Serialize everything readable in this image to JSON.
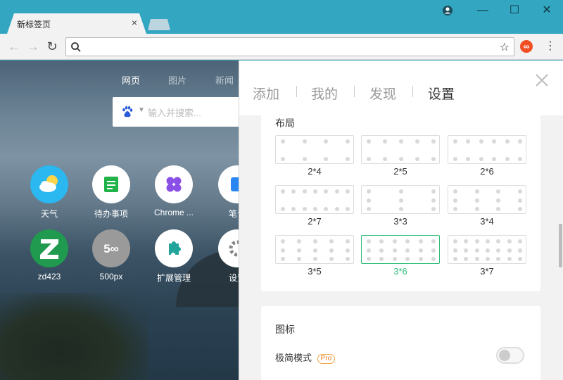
{
  "browser": {
    "tab_title": "新标签页",
    "tab_close": "×",
    "window_controls": {
      "minimize": "—",
      "maximize": "☐",
      "close": "✕"
    },
    "address_value": "",
    "ext_label": "∞"
  },
  "newtab": {
    "search_tabs": [
      "网页",
      "图片",
      "新闻"
    ],
    "search_placeholder": "输入并搜索...",
    "apps": [
      {
        "label": "天气",
        "icon": "weather-icon",
        "color": "#2bb7f0"
      },
      {
        "label": "待办事项",
        "icon": "todo-icon",
        "color": "#ffffff"
      },
      {
        "label": "Chrome ...",
        "icon": "chrome-store-icon",
        "color": "#ffffff"
      },
      {
        "label": "笔记",
        "icon": "notes-icon",
        "color": "#ffffff"
      },
      {
        "label": "zd423",
        "icon": "zd423-icon",
        "color": "#1f9a4f"
      },
      {
        "label": "500px",
        "icon": "500px-icon",
        "color": "#9a9a9a"
      },
      {
        "label": "扩展管理",
        "icon": "extensions-icon",
        "color": "#ffffff"
      },
      {
        "label": "设置",
        "icon": "settings-icon",
        "color": "#ffffff"
      }
    ]
  },
  "settings_panel": {
    "tabs": [
      "添加",
      "我的",
      "发现",
      "设置"
    ],
    "active_tab": "设置",
    "layout_section": {
      "title": "布局",
      "options": [
        {
          "label": "2*4",
          "rows": 2,
          "cols": 4,
          "selected": false
        },
        {
          "label": "2*5",
          "rows": 2,
          "cols": 5,
          "selected": false
        },
        {
          "label": "2*6",
          "rows": 2,
          "cols": 6,
          "selected": false
        },
        {
          "label": "2*7",
          "rows": 2,
          "cols": 7,
          "selected": false
        },
        {
          "label": "3*3",
          "rows": 3,
          "cols": 3,
          "selected": false
        },
        {
          "label": "3*4",
          "rows": 3,
          "cols": 4,
          "selected": false
        },
        {
          "label": "3*5",
          "rows": 3,
          "cols": 5,
          "selected": false
        },
        {
          "label": "3*6",
          "rows": 3,
          "cols": 6,
          "selected": true
        },
        {
          "label": "3*7",
          "rows": 3,
          "cols": 7,
          "selected": false
        }
      ]
    },
    "icon_section": {
      "title": "图标",
      "minimal_mode_label": "极简模式",
      "pro_badge": "Pro",
      "minimal_mode_on": false
    }
  },
  "colors": {
    "accent_green": "#2fbf7a",
    "titlebar": "#33a6c2"
  }
}
